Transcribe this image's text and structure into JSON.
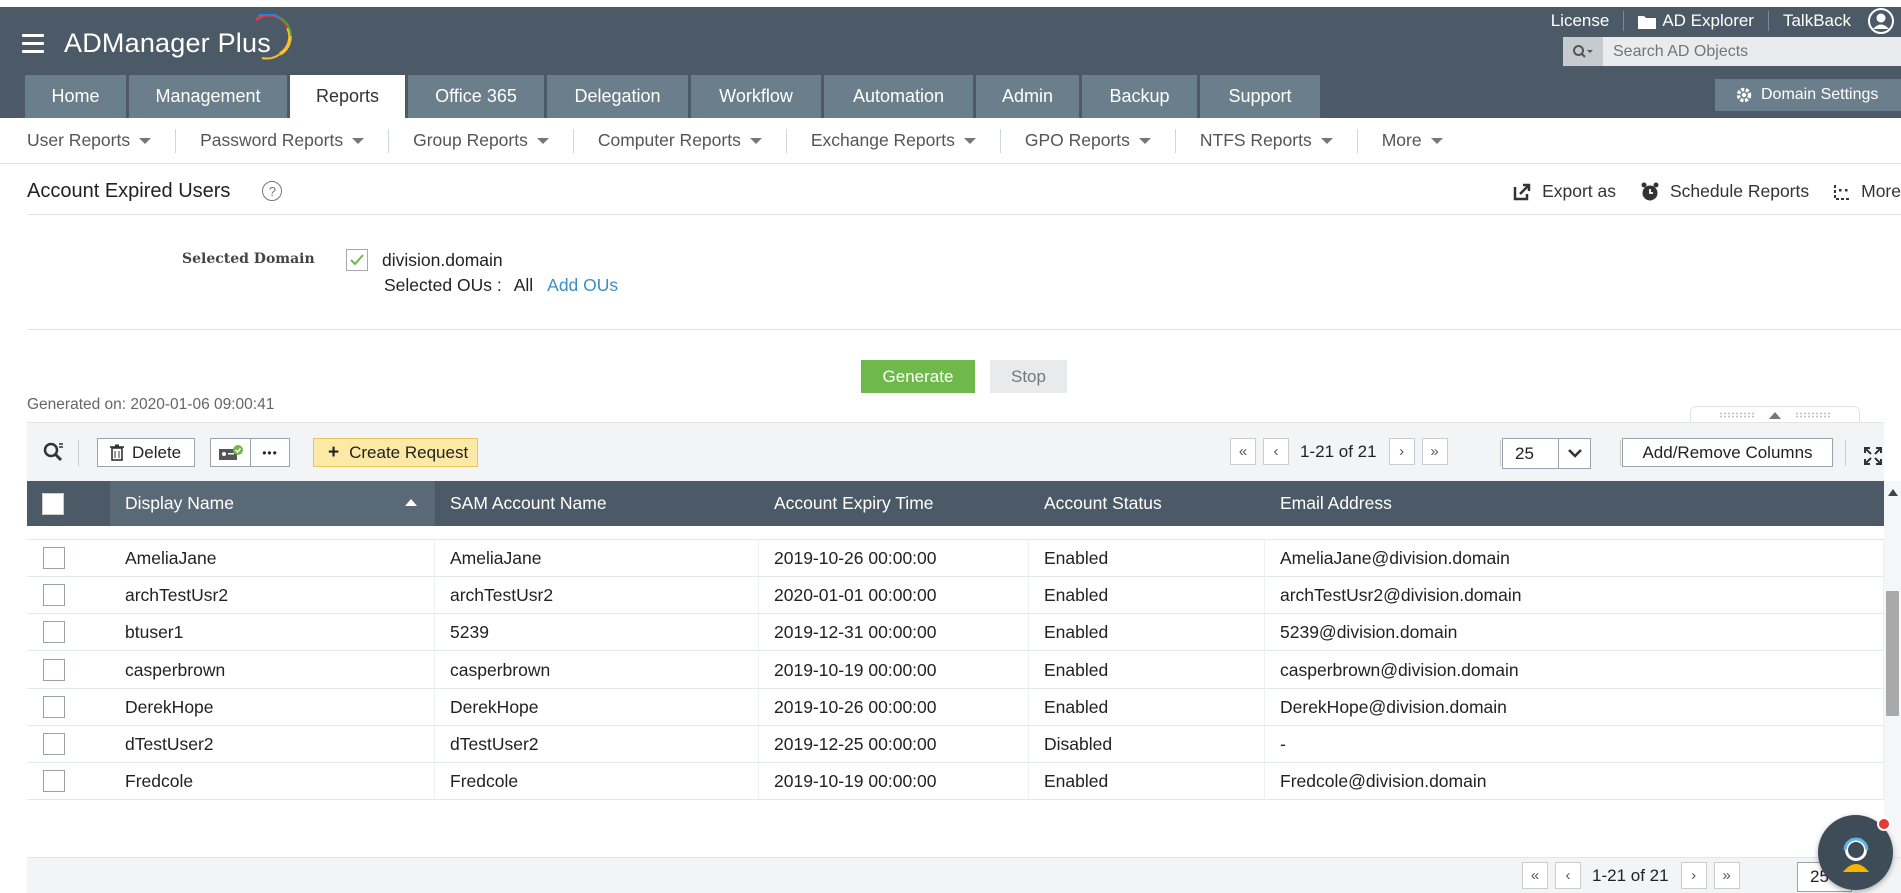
{
  "app": {
    "name": "ADManager Plus",
    "top_links": [
      "License",
      "AD Explorer",
      "TalkBack"
    ],
    "search_placeholder": "Search AD Objects",
    "domain_settings": "Domain Settings"
  },
  "main_tabs": [
    {
      "label": "Home",
      "active": false
    },
    {
      "label": "Management",
      "active": false
    },
    {
      "label": "Reports",
      "active": true
    },
    {
      "label": "Office 365",
      "active": false
    },
    {
      "label": "Delegation",
      "active": false
    },
    {
      "label": "Workflow",
      "active": false
    },
    {
      "label": "Automation",
      "active": false
    },
    {
      "label": "Admin",
      "active": false
    },
    {
      "label": "Backup",
      "active": false
    },
    {
      "label": "Support",
      "active": false
    }
  ],
  "sub_nav": [
    "User Reports",
    "Password Reports",
    "Group Reports",
    "Computer Reports",
    "Exchange Reports",
    "GPO Reports",
    "NTFS Reports",
    "More"
  ],
  "report": {
    "title": "Account Expired Users",
    "actions": [
      "Export as",
      "Schedule Reports",
      "More"
    ]
  },
  "filter": {
    "selected_domain_label": "Selected Domain",
    "domain": "division.domain",
    "selected_ous_label": "Selected OUs :",
    "selected_ous_value": "All",
    "add_ous": "Add OUs"
  },
  "buttons": {
    "generate": "Generate",
    "stop": "Stop"
  },
  "generated_on": "Generated on: 2020-01-06 09:00:41",
  "toolbar": {
    "delete": "Delete",
    "more": "•••",
    "create_request": "Create Request",
    "page_range": "1-21 of 21",
    "page_size": "25",
    "add_remove_columns": "Add/Remove Columns"
  },
  "table": {
    "columns": [
      "Display Name",
      "SAM Account Name",
      "Account Expiry Time",
      "Account Status",
      "Email Address"
    ],
    "rows": [
      [
        "AmeliaJane",
        "AmeliaJane",
        "2019-10-26 00:00:00",
        "Enabled",
        "AmeliaJane@division.domain"
      ],
      [
        "archTestUsr2",
        "archTestUsr2",
        "2020-01-01 00:00:00",
        "Enabled",
        "archTestUsr2@division.domain"
      ],
      [
        "btuser1",
        "5239",
        "2019-12-31 00:00:00",
        "Enabled",
        "5239@division.domain"
      ],
      [
        "casperbrown",
        "casperbrown",
        "2019-10-19 00:00:00",
        "Enabled",
        "casperbrown@division.domain"
      ],
      [
        "DerekHope",
        "DerekHope",
        "2019-10-26 00:00:00",
        "Enabled",
        "DerekHope@division.domain"
      ],
      [
        "dTestUser2",
        "dTestUser2",
        "2019-12-25 00:00:00",
        "Disabled",
        "-"
      ],
      [
        "Fredcole",
        "Fredcole",
        "2019-10-19 00:00:00",
        "Enabled",
        "Fredcole@division.domain"
      ]
    ]
  },
  "bottom_pager": {
    "page_range": "1-21 of 21",
    "page_size": "25"
  },
  "colors": {
    "header_bg": "#4b5a66",
    "tab_bg": "#6b7e8b",
    "generate_green": "#6fb84a",
    "create_request_bg": "#fde9a6",
    "link_blue": "#3d8fc2"
  }
}
